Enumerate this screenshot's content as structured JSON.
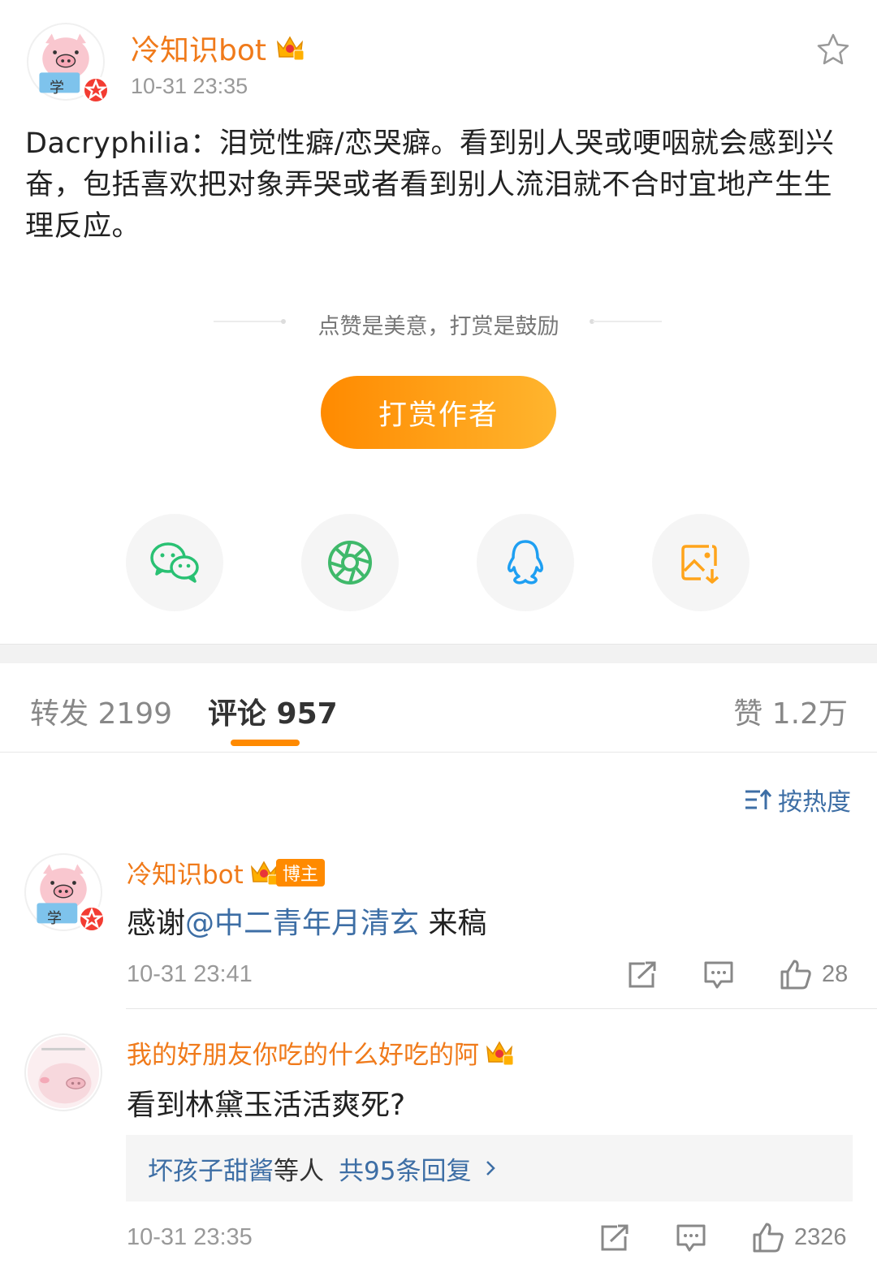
{
  "post": {
    "author": "冷知识bot",
    "time": "10-31 23:35",
    "text": "Dacryphilia：泪觉性癖/恋哭癖。看到别人哭或哽咽就会感到兴奋，包括喜欢把对象弄哭或者看到别人流泪就不合时宜地产生生理反应。",
    "avatar_text": "学"
  },
  "reward": {
    "caption": "点赞是美意，打赏是鼓励",
    "button_label": "打赏作者"
  },
  "share": [
    "wechat-icon",
    "moments-icon",
    "qq-icon",
    "save-image-icon"
  ],
  "tabs": {
    "repost": "转发 2199",
    "comments": "评论 957",
    "likes": "赞 1.2万"
  },
  "sort_label": "按热度",
  "comments": [
    {
      "name": "冷知识bot",
      "tag": "博主",
      "text_prefix": "感谢",
      "mention": "@中二青年月清玄",
      "text_suffix": " 来稿",
      "time": "10-31 23:41",
      "likes": "28"
    },
    {
      "name": "我的好朋友你吃的什么好吃的阿",
      "text": "看到林黛玉活活爽死?",
      "reply_users": "坏孩子甜酱",
      "reply_mid": "等人",
      "reply_count": "共95条回复",
      "time": "10-31 23:35",
      "likes": "2326"
    }
  ],
  "colors": {
    "accent_orange": "#ff8a00",
    "name_orange": "#f07a1a",
    "link_blue": "#3d6ea5"
  }
}
